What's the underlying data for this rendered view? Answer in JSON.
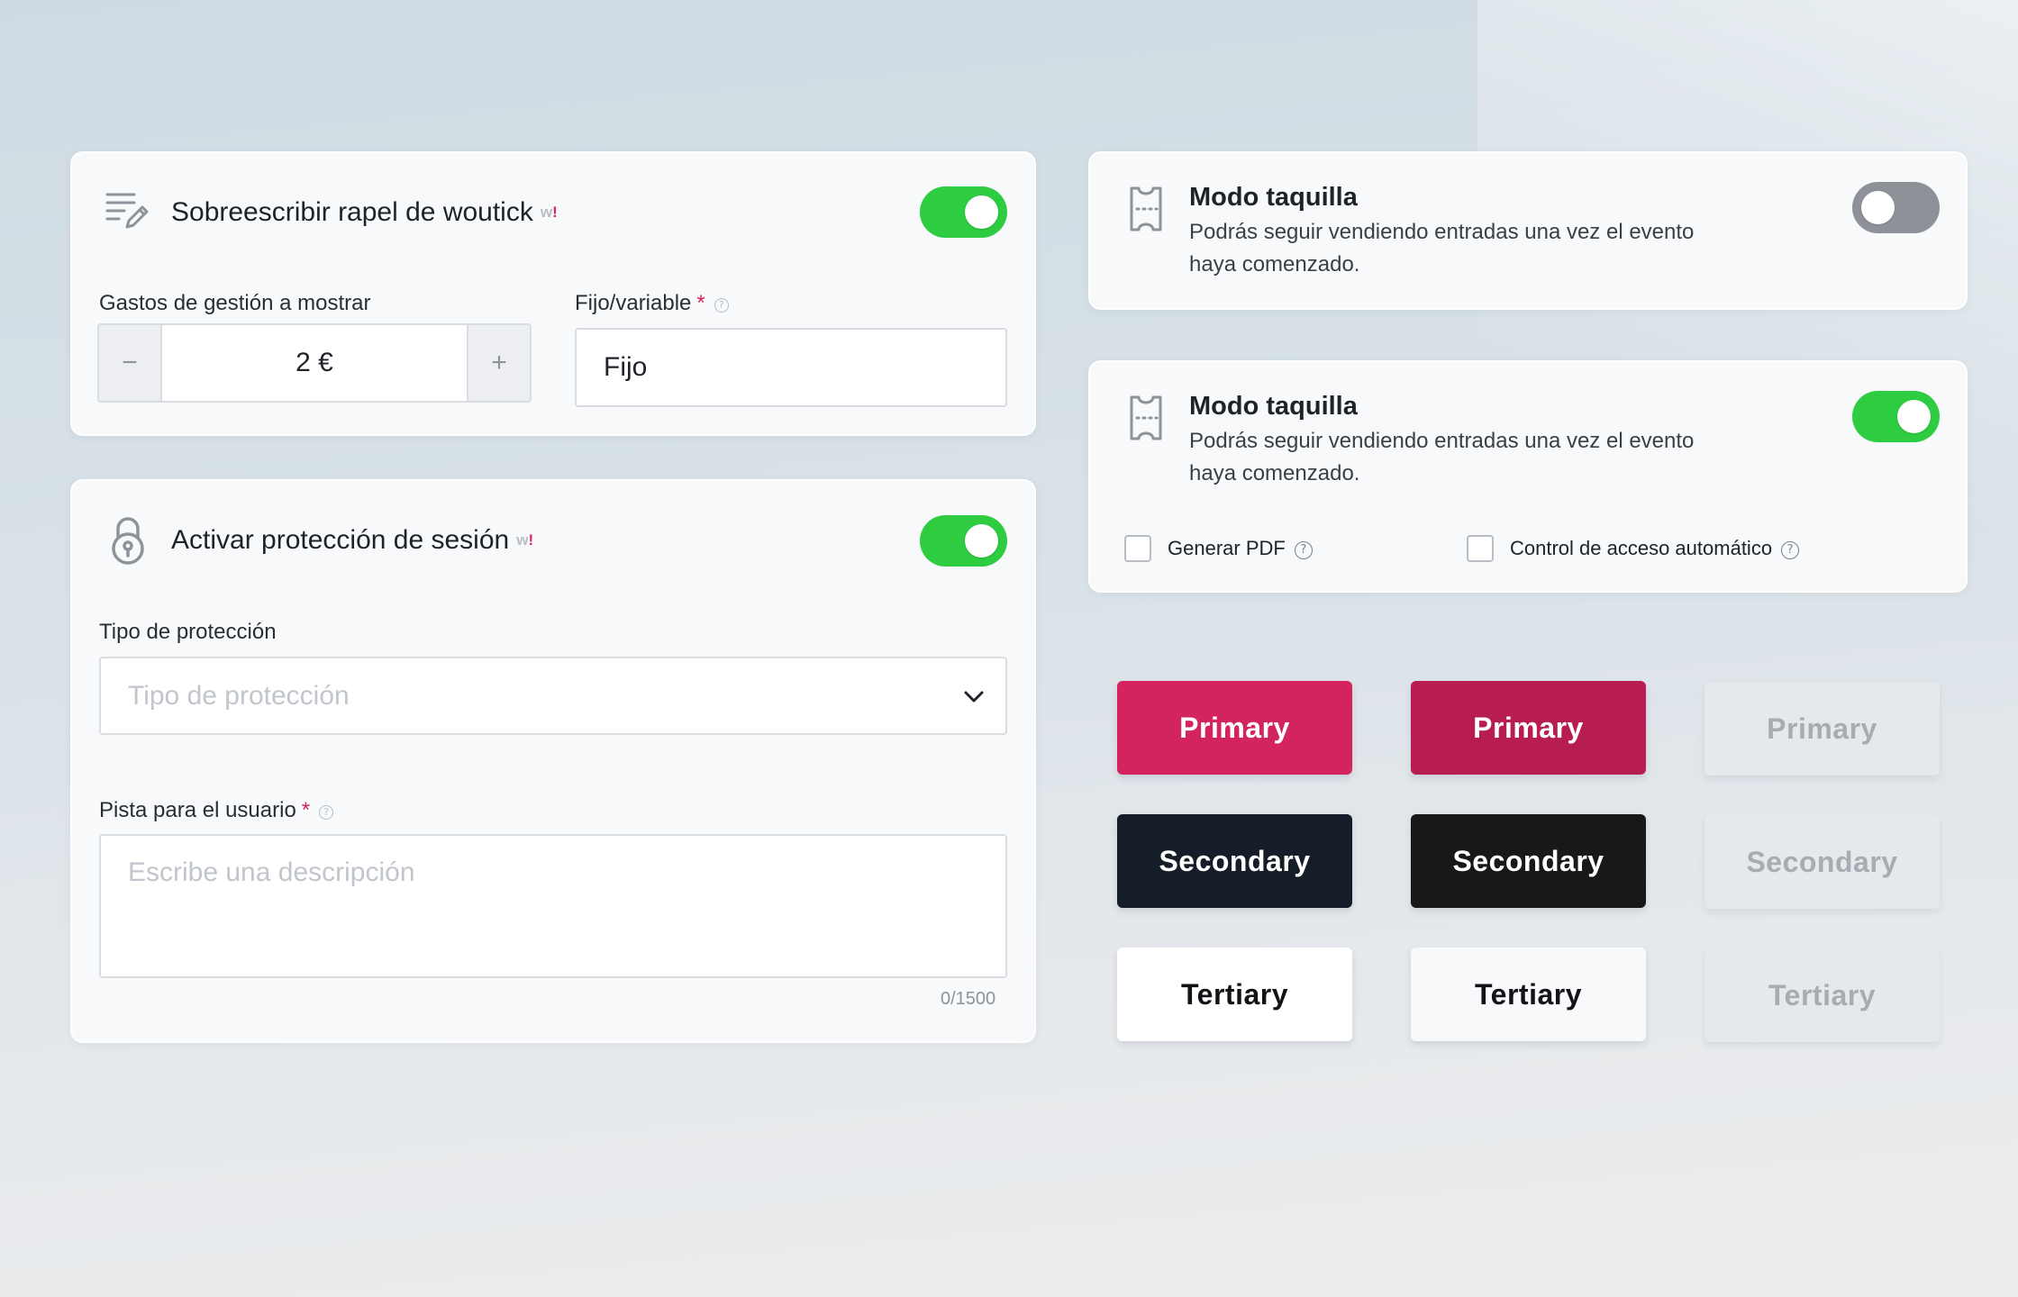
{
  "colors": {
    "toggle_on": "#2ecc40",
    "toggle_off": "#8e9298",
    "primary": "#d3245f",
    "primary_hover": "#b71d52",
    "secondary": "#151e28",
    "required": "#d6245f"
  },
  "card_rapel": {
    "icon": "pencil-lines-icon",
    "title": "Sobreescribir rapel de woutick",
    "badge": "w!",
    "toggle_on": true,
    "fees_label": "Gastos de gestión a mostrar",
    "stepper": {
      "minus": "−",
      "value": "2 €",
      "plus": "+"
    },
    "type_label": "Fijo/variable",
    "required_mark": "*",
    "help_glyph": "?",
    "type_value": "Fijo"
  },
  "card_session": {
    "icon": "padlock-icon",
    "title": "Activar protección de sesión",
    "badge": "w!",
    "toggle_on": true,
    "protection_label": "Tipo de protección",
    "protection_placeholder": "Tipo de protección",
    "hint_label": "Pista para el usuario",
    "required_mark": "*",
    "help_glyph": "?",
    "hint_placeholder": "Escribe una descripción",
    "counter": "0/1500"
  },
  "card_taquilla_off": {
    "icon": "ticket-icon",
    "title": "Modo taquilla",
    "description_line1": "Podrás seguir vendiendo entradas una vez el evento",
    "description_line2": "haya comenzado.",
    "toggle_on": false
  },
  "card_taquilla_on": {
    "icon": "ticket-icon",
    "title": "Modo taquilla",
    "description_line1": "Podrás seguir vendiendo entradas una vez el evento",
    "description_line2": "haya comenzado.",
    "toggle_on": true,
    "checkbox_pdf": {
      "label": "Generar PDF",
      "checked": false
    },
    "checkbox_access": {
      "label": "Control de acceso automático",
      "checked": false
    },
    "help_glyph": "?"
  },
  "buttons": {
    "primary": "Primary",
    "secondary": "Secondary",
    "tertiary": "Tertiary",
    "states": [
      "default",
      "hover",
      "disabled"
    ]
  }
}
